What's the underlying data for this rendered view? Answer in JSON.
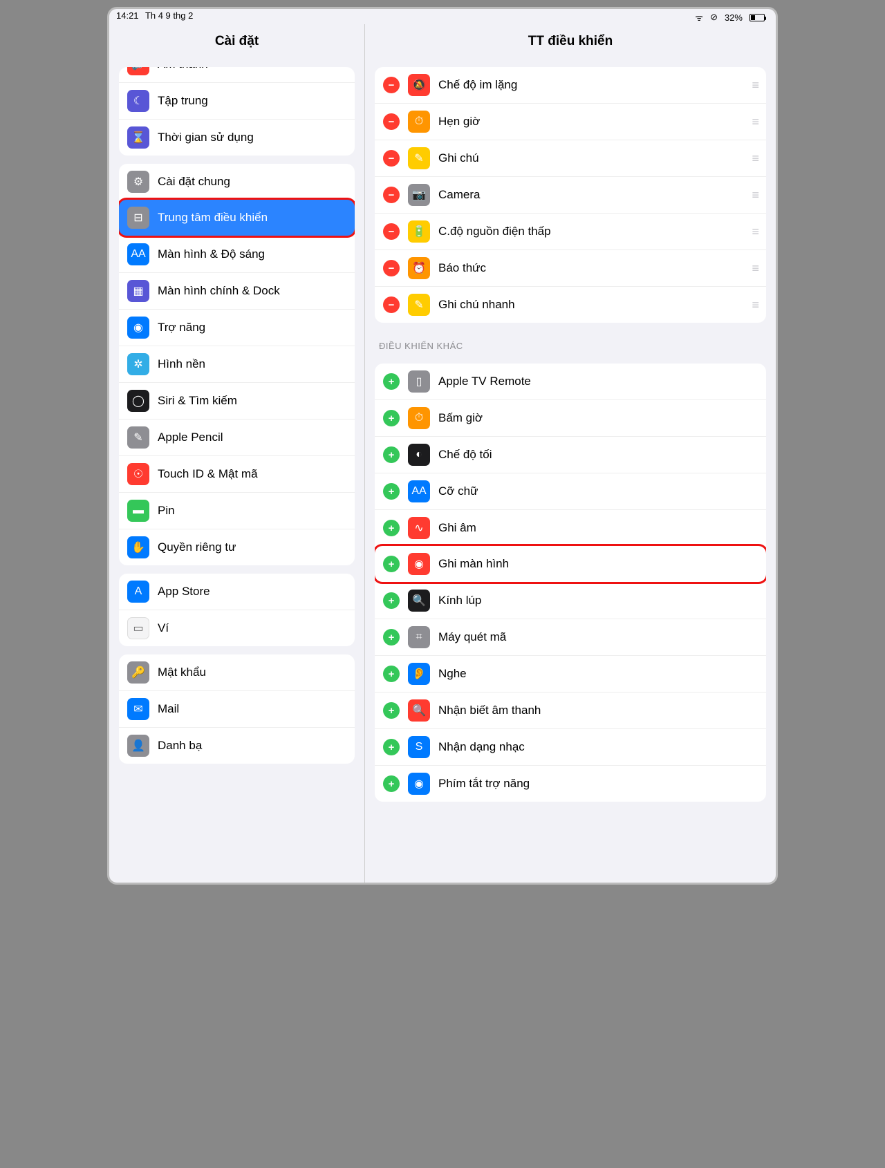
{
  "status": {
    "time": "14:21",
    "date": "Th 4 9 thg 2",
    "battery": "32%"
  },
  "sidebar": {
    "title": "Cài đặt",
    "groups": [
      {
        "items": [
          {
            "icon": "bg-red",
            "glyph": "🔊",
            "label": "Âm thanh",
            "cut": true
          },
          {
            "icon": "bg-indigo",
            "glyph": "☾",
            "label": "Tập trung"
          },
          {
            "icon": "bg-indigo",
            "glyph": "⌛",
            "label": "Thời gian sử dụng"
          }
        ]
      },
      {
        "items": [
          {
            "icon": "bg-gray",
            "glyph": "⚙",
            "label": "Cài đặt chung"
          },
          {
            "icon": "bg-gray",
            "glyph": "⊟",
            "label": "Trung tâm điều khiển",
            "selected": true,
            "highlight": true
          },
          {
            "icon": "bg-blue",
            "glyph": "AA",
            "label": "Màn hình & Độ sáng"
          },
          {
            "icon": "bg-indigo",
            "glyph": "▦",
            "label": "Màn hình chính & Dock"
          },
          {
            "icon": "bg-blue",
            "glyph": "◉",
            "label": "Trợ năng"
          },
          {
            "icon": "bg-cyan",
            "glyph": "✲",
            "label": "Hình nền"
          },
          {
            "icon": "bg-dark",
            "glyph": "◯",
            "label": "Siri & Tìm kiếm"
          },
          {
            "icon": "bg-gray",
            "glyph": "✎",
            "label": "Apple Pencil"
          },
          {
            "icon": "bg-red",
            "glyph": "☉",
            "label": "Touch ID & Mật mã"
          },
          {
            "icon": "bg-green",
            "glyph": "▬",
            "label": "Pin"
          },
          {
            "icon": "bg-blue",
            "glyph": "✋",
            "label": "Quyền riêng tư"
          }
        ]
      },
      {
        "items": [
          {
            "icon": "bg-blue",
            "glyph": "A",
            "label": "App Store"
          },
          {
            "icon": "bg-white",
            "glyph": "▭",
            "label": "Ví"
          }
        ]
      },
      {
        "items": [
          {
            "icon": "bg-gray",
            "glyph": "🔑",
            "label": "Mật khẩu"
          },
          {
            "icon": "bg-blue",
            "glyph": "✉",
            "label": "Mail"
          },
          {
            "icon": "bg-gray",
            "glyph": "👤",
            "label": "Danh bạ"
          }
        ]
      }
    ]
  },
  "main": {
    "title": "TT điều khiển",
    "included": [
      {
        "icon": "bg-red",
        "glyph": "🔕",
        "label": "Chế độ im lặng"
      },
      {
        "icon": "bg-orange",
        "glyph": "⏱",
        "label": "Hẹn giờ"
      },
      {
        "icon": "bg-yellow",
        "glyph": "✎",
        "label": "Ghi chú"
      },
      {
        "icon": "bg-gray",
        "glyph": "📷",
        "label": "Camera"
      },
      {
        "icon": "bg-yellow",
        "glyph": "🔋",
        "label": "C.độ nguồn điện thấp"
      },
      {
        "icon": "bg-orange",
        "glyph": "⏰",
        "label": "Báo thức"
      },
      {
        "icon": "bg-yellow",
        "glyph": "✎",
        "label": "Ghi chú nhanh"
      }
    ],
    "otherTitle": "ĐIỀU KHIỂN KHÁC",
    "other": [
      {
        "icon": "bg-gray",
        "glyph": "▯",
        "label": "Apple TV Remote"
      },
      {
        "icon": "bg-orange",
        "glyph": "⏱",
        "label": "Bấm giờ"
      },
      {
        "icon": "bg-dark",
        "glyph": "◐",
        "label": "Chế độ tối"
      },
      {
        "icon": "bg-blue",
        "glyph": "AA",
        "label": "Cỡ chữ"
      },
      {
        "icon": "bg-red",
        "glyph": "∿",
        "label": "Ghi âm"
      },
      {
        "icon": "bg-red",
        "glyph": "◉",
        "label": "Ghi màn hình",
        "highlight": true
      },
      {
        "icon": "bg-dark",
        "glyph": "🔍",
        "label": "Kính lúp"
      },
      {
        "icon": "bg-gray",
        "glyph": "⌗",
        "label": "Máy quét mã"
      },
      {
        "icon": "bg-blue",
        "glyph": "👂",
        "label": "Nghe"
      },
      {
        "icon": "bg-red",
        "glyph": "🔍",
        "label": "Nhận biết âm thanh"
      },
      {
        "icon": "bg-blue",
        "glyph": "S",
        "label": "Nhận dạng nhạc"
      },
      {
        "icon": "bg-blue",
        "glyph": "◉",
        "label": "Phím tắt trợ năng"
      }
    ]
  }
}
